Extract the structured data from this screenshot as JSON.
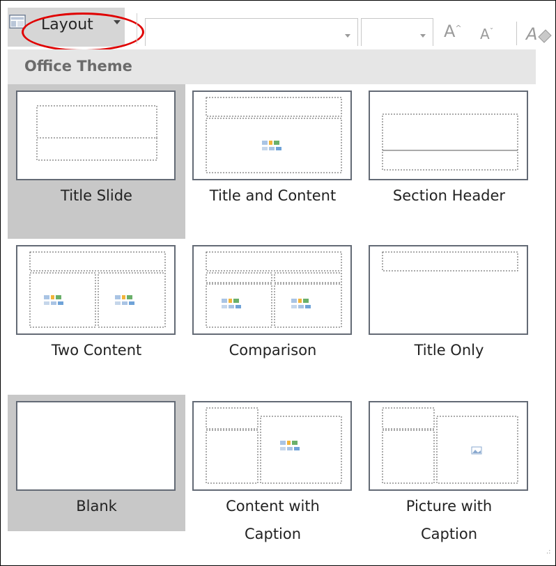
{
  "ribbon": {
    "layout_label": "Layout",
    "font_grow_label": "A",
    "font_shrink_label": "A"
  },
  "gallery": {
    "header": "Office Theme",
    "layouts": [
      {
        "label": "Title Slide",
        "label2": "",
        "selected": true
      },
      {
        "label": "Title and Content",
        "label2": "",
        "selected": false
      },
      {
        "label": "Section Header",
        "label2": "",
        "selected": false
      },
      {
        "label": "Two Content",
        "label2": "",
        "selected": false
      },
      {
        "label": "Comparison",
        "label2": "",
        "selected": false
      },
      {
        "label": "Title Only",
        "label2": "",
        "selected": false
      },
      {
        "label": "Blank",
        "label2": "",
        "selected": true
      },
      {
        "label": "Content with",
        "label2": "Caption",
        "selected": false
      },
      {
        "label": "Picture with",
        "label2": "Caption",
        "selected": false
      }
    ]
  },
  "colors": {
    "selected_bg": "#c8c8c8",
    "header_bg": "#e6e6e6",
    "annotation_oval": "#e00000"
  }
}
